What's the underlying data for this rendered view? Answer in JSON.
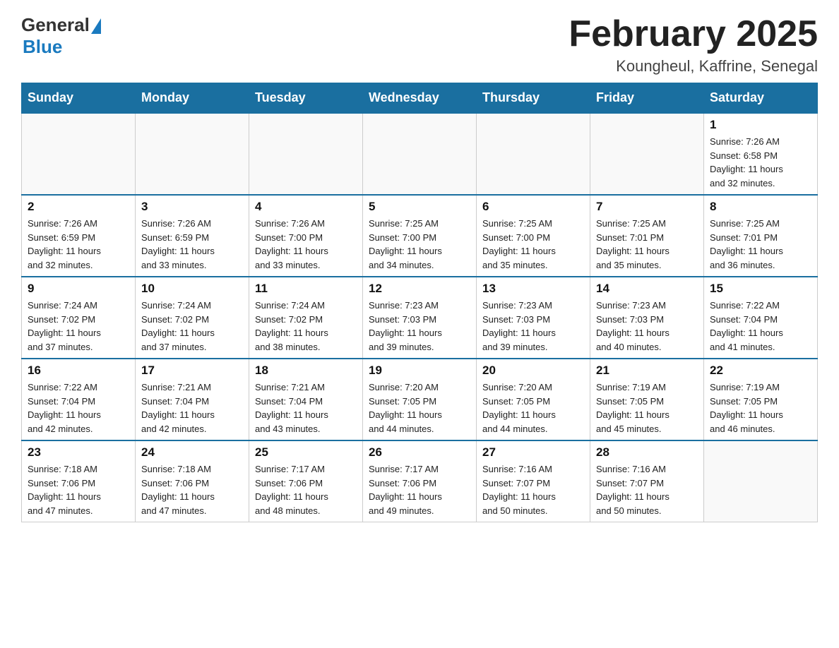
{
  "header": {
    "logo_general": "General",
    "logo_blue": "Blue",
    "title": "February 2025",
    "location": "Koungheul, Kaffrine, Senegal"
  },
  "weekdays": [
    "Sunday",
    "Monday",
    "Tuesday",
    "Wednesday",
    "Thursday",
    "Friday",
    "Saturday"
  ],
  "weeks": [
    [
      {
        "day": "",
        "info": ""
      },
      {
        "day": "",
        "info": ""
      },
      {
        "day": "",
        "info": ""
      },
      {
        "day": "",
        "info": ""
      },
      {
        "day": "",
        "info": ""
      },
      {
        "day": "",
        "info": ""
      },
      {
        "day": "1",
        "info": "Sunrise: 7:26 AM\nSunset: 6:58 PM\nDaylight: 11 hours\nand 32 minutes."
      }
    ],
    [
      {
        "day": "2",
        "info": "Sunrise: 7:26 AM\nSunset: 6:59 PM\nDaylight: 11 hours\nand 32 minutes."
      },
      {
        "day": "3",
        "info": "Sunrise: 7:26 AM\nSunset: 6:59 PM\nDaylight: 11 hours\nand 33 minutes."
      },
      {
        "day": "4",
        "info": "Sunrise: 7:26 AM\nSunset: 7:00 PM\nDaylight: 11 hours\nand 33 minutes."
      },
      {
        "day": "5",
        "info": "Sunrise: 7:25 AM\nSunset: 7:00 PM\nDaylight: 11 hours\nand 34 minutes."
      },
      {
        "day": "6",
        "info": "Sunrise: 7:25 AM\nSunset: 7:00 PM\nDaylight: 11 hours\nand 35 minutes."
      },
      {
        "day": "7",
        "info": "Sunrise: 7:25 AM\nSunset: 7:01 PM\nDaylight: 11 hours\nand 35 minutes."
      },
      {
        "day": "8",
        "info": "Sunrise: 7:25 AM\nSunset: 7:01 PM\nDaylight: 11 hours\nand 36 minutes."
      }
    ],
    [
      {
        "day": "9",
        "info": "Sunrise: 7:24 AM\nSunset: 7:02 PM\nDaylight: 11 hours\nand 37 minutes."
      },
      {
        "day": "10",
        "info": "Sunrise: 7:24 AM\nSunset: 7:02 PM\nDaylight: 11 hours\nand 37 minutes."
      },
      {
        "day": "11",
        "info": "Sunrise: 7:24 AM\nSunset: 7:02 PM\nDaylight: 11 hours\nand 38 minutes."
      },
      {
        "day": "12",
        "info": "Sunrise: 7:23 AM\nSunset: 7:03 PM\nDaylight: 11 hours\nand 39 minutes."
      },
      {
        "day": "13",
        "info": "Sunrise: 7:23 AM\nSunset: 7:03 PM\nDaylight: 11 hours\nand 39 minutes."
      },
      {
        "day": "14",
        "info": "Sunrise: 7:23 AM\nSunset: 7:03 PM\nDaylight: 11 hours\nand 40 minutes."
      },
      {
        "day": "15",
        "info": "Sunrise: 7:22 AM\nSunset: 7:04 PM\nDaylight: 11 hours\nand 41 minutes."
      }
    ],
    [
      {
        "day": "16",
        "info": "Sunrise: 7:22 AM\nSunset: 7:04 PM\nDaylight: 11 hours\nand 42 minutes."
      },
      {
        "day": "17",
        "info": "Sunrise: 7:21 AM\nSunset: 7:04 PM\nDaylight: 11 hours\nand 42 minutes."
      },
      {
        "day": "18",
        "info": "Sunrise: 7:21 AM\nSunset: 7:04 PM\nDaylight: 11 hours\nand 43 minutes."
      },
      {
        "day": "19",
        "info": "Sunrise: 7:20 AM\nSunset: 7:05 PM\nDaylight: 11 hours\nand 44 minutes."
      },
      {
        "day": "20",
        "info": "Sunrise: 7:20 AM\nSunset: 7:05 PM\nDaylight: 11 hours\nand 44 minutes."
      },
      {
        "day": "21",
        "info": "Sunrise: 7:19 AM\nSunset: 7:05 PM\nDaylight: 11 hours\nand 45 minutes."
      },
      {
        "day": "22",
        "info": "Sunrise: 7:19 AM\nSunset: 7:05 PM\nDaylight: 11 hours\nand 46 minutes."
      }
    ],
    [
      {
        "day": "23",
        "info": "Sunrise: 7:18 AM\nSunset: 7:06 PM\nDaylight: 11 hours\nand 47 minutes."
      },
      {
        "day": "24",
        "info": "Sunrise: 7:18 AM\nSunset: 7:06 PM\nDaylight: 11 hours\nand 47 minutes."
      },
      {
        "day": "25",
        "info": "Sunrise: 7:17 AM\nSunset: 7:06 PM\nDaylight: 11 hours\nand 48 minutes."
      },
      {
        "day": "26",
        "info": "Sunrise: 7:17 AM\nSunset: 7:06 PM\nDaylight: 11 hours\nand 49 minutes."
      },
      {
        "day": "27",
        "info": "Sunrise: 7:16 AM\nSunset: 7:07 PM\nDaylight: 11 hours\nand 50 minutes."
      },
      {
        "day": "28",
        "info": "Sunrise: 7:16 AM\nSunset: 7:07 PM\nDaylight: 11 hours\nand 50 minutes."
      },
      {
        "day": "",
        "info": ""
      }
    ]
  ]
}
